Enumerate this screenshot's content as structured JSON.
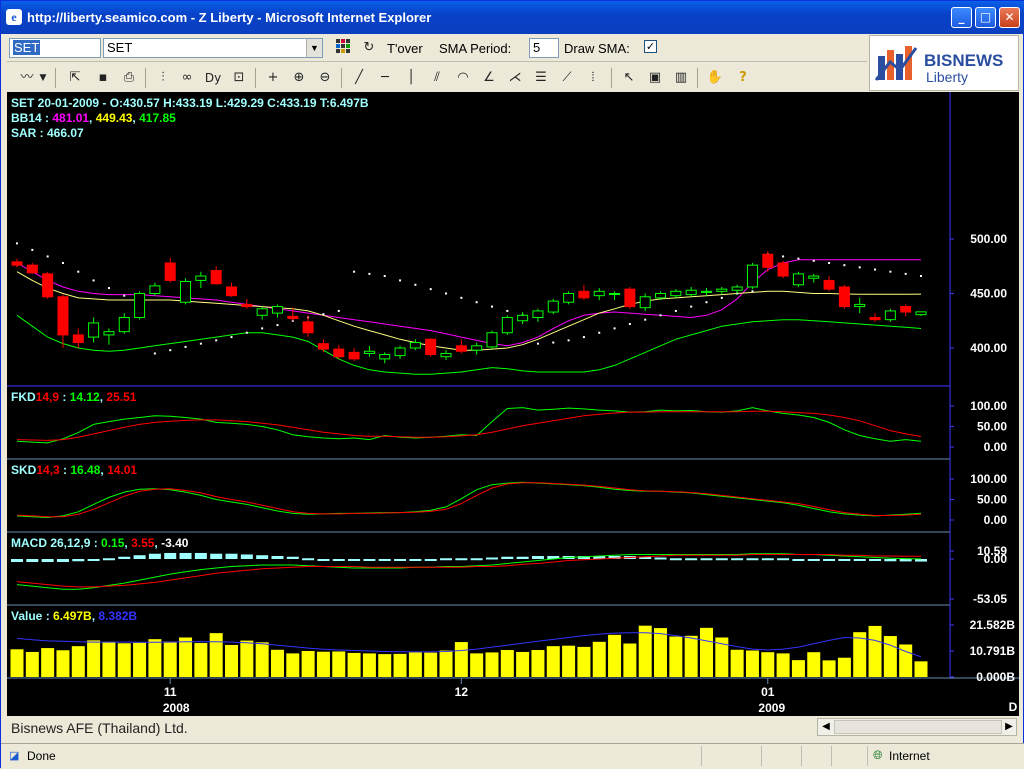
{
  "window": {
    "title": "http://liberty.seamico.com - Z Liberty - Microsoft Internet Explorer",
    "buttons": {
      "min": "_",
      "max": "□",
      "close": "✕"
    }
  },
  "toolbar": {
    "symbol_value": "SET",
    "symbol_select_value": "SET",
    "tover_label": "T'over",
    "sma_period_label": "SMA Period:",
    "sma_period_value": "5",
    "draw_sma_label": "Draw SMA:",
    "draw_sma_checked": "✓"
  },
  "logo": {
    "brand": "BISNEWS",
    "sub": "Liberty",
    "accent": "#e8612c",
    "blue": "#2b4ea0"
  },
  "panels": {
    "main": {
      "line1": "SET 20-01-2009 - O:430.57 H:433.19 L:429.29 C:433.19 T:6.497B",
      "bb_label": "BB14 : ",
      "bb_values": [
        "481.01",
        "449.43",
        "417.85"
      ],
      "sar_label": "SAR : 466.07",
      "y_ticks": [
        "500.00",
        "450.00",
        "400.00"
      ]
    },
    "fkd": {
      "name": "FKD",
      "params": "14,9",
      "colon": " : ",
      "v1": "14.12",
      "v2": "25.51",
      "y_ticks": [
        "100.00",
        "50.00",
        "0.00"
      ]
    },
    "skd": {
      "name": "SKD",
      "params": "14,3",
      "colon": " : ",
      "v1": "16.48",
      "v2": "14.01",
      "y_ticks": [
        "100.00",
        "50.00",
        "0.00"
      ]
    },
    "macd": {
      "name": "MACD 26,12,9 : ",
      "v1": "0.15",
      "v2": "3.55",
      "v3": "-3.40",
      "y_ticks": [
        "10.59",
        "0.00",
        "-53.05"
      ]
    },
    "value": {
      "name": "Value : ",
      "v1": "6.497B",
      "v2": "8.382B",
      "y_ticks": [
        "21.582B",
        "10.791B",
        "0.000B"
      ]
    }
  },
  "x_axis": {
    "months": [
      "11",
      "12",
      "01"
    ],
    "years": [
      "2008",
      "2009"
    ],
    "period": "D"
  },
  "colors": {
    "up": "#00ff00",
    "down": "#ff0000",
    "bb_upper": "#ff00ff",
    "bb_mid": "#ffff80",
    "bb_lower": "#00ff00",
    "axis": "#3a3aff",
    "vol": "#ffff00",
    "vol_ma": "#3333ff",
    "macd_hist": "#a0ffff"
  },
  "status_bar": {
    "company": "Bisnews AFE (Thailand) Ltd."
  },
  "ie_status": {
    "done": "Done",
    "zone": "Internet"
  },
  "chart_data": {
    "type": "candlestick",
    "title": "SET",
    "ylabel": "",
    "candles_ohlc": [
      [
        479,
        482,
        474,
        476
      ],
      [
        476,
        478,
        468,
        469
      ],
      [
        468,
        470,
        445,
        447
      ],
      [
        447,
        449,
        400,
        412
      ],
      [
        412,
        418,
        400,
        405
      ],
      [
        410,
        428,
        405,
        423
      ],
      [
        412,
        418,
        403,
        415
      ],
      [
        415,
        432,
        413,
        428
      ],
      [
        428,
        452,
        426,
        450
      ],
      [
        450,
        460,
        448,
        457
      ],
      [
        478,
        483,
        460,
        462
      ],
      [
        442,
        464,
        440,
        461
      ],
      [
        462,
        470,
        455,
        466
      ],
      [
        471,
        475,
        458,
        459
      ],
      [
        456,
        460,
        447,
        448
      ],
      [
        440,
        445,
        436,
        438
      ],
      [
        430,
        438,
        426,
        436
      ],
      [
        432,
        440,
        428,
        438
      ],
      [
        429,
        437,
        425,
        427
      ],
      [
        424,
        430,
        410,
        414
      ],
      [
        404,
        408,
        396,
        399
      ],
      [
        399,
        403,
        390,
        392
      ],
      [
        396,
        400,
        388,
        390
      ],
      [
        395,
        402,
        392,
        397
      ],
      [
        390,
        396,
        386,
        394
      ],
      [
        393,
        402,
        390,
        400
      ],
      [
        400,
        408,
        398,
        405
      ],
      [
        408,
        409,
        392,
        394
      ],
      [
        392,
        398,
        389,
        395
      ],
      [
        402,
        408,
        395,
        397
      ],
      [
        398,
        405,
        394,
        402
      ],
      [
        401,
        416,
        399,
        414
      ],
      [
        414,
        430,
        412,
        428
      ],
      [
        425,
        433,
        422,
        430
      ],
      [
        428,
        436,
        424,
        434
      ],
      [
        433,
        445,
        431,
        443
      ],
      [
        442,
        452,
        440,
        450
      ],
      [
        452,
        458,
        444,
        446
      ],
      [
        448,
        455,
        444,
        452
      ],
      [
        450,
        452,
        444,
        450
      ],
      [
        454,
        456,
        436,
        438
      ],
      [
        437,
        450,
        434,
        447
      ],
      [
        446,
        452,
        444,
        450
      ],
      [
        448,
        454,
        446,
        452
      ],
      [
        449,
        456,
        447,
        453
      ],
      [
        451,
        455,
        448,
        452
      ],
      [
        452,
        456,
        449,
        454
      ],
      [
        453,
        458,
        450,
        456
      ],
      [
        456,
        478,
        454,
        476
      ],
      [
        486,
        489,
        470,
        474
      ],
      [
        478,
        480,
        464,
        466
      ],
      [
        458,
        470,
        456,
        468
      ],
      [
        464,
        468,
        460,
        466
      ],
      [
        462,
        466,
        452,
        454
      ],
      [
        456,
        458,
        436,
        438
      ],
      [
        438,
        446,
        432,
        440
      ],
      [
        428,
        432,
        424,
        426
      ],
      [
        426,
        436,
        424,
        434
      ],
      [
        438,
        440,
        429,
        433
      ],
      [
        430.57,
        433.19,
        429.29,
        433.19
      ]
    ],
    "bb_upper": [
      478,
      470,
      462,
      456,
      452,
      450,
      449,
      449,
      449,
      448,
      447,
      446,
      445,
      444,
      442,
      440,
      438,
      436,
      434,
      432,
      430,
      428,
      426,
      424,
      422,
      420,
      418,
      416,
      413,
      410,
      407,
      404,
      402,
      405,
      410,
      418,
      425,
      430,
      432,
      433,
      432,
      431,
      430,
      429,
      428,
      430,
      435,
      445,
      460,
      472,
      478,
      481,
      481,
      481,
      481,
      481,
      481,
      481,
      481,
      481.01
    ],
    "bb_mid": [
      470,
      462,
      455,
      450,
      446,
      445,
      444,
      444,
      444,
      444,
      444,
      443,
      442,
      441,
      440,
      439,
      438,
      437,
      436,
      434,
      430,
      425,
      420,
      416,
      412,
      408,
      405,
      402,
      400,
      398,
      398,
      399,
      400,
      403,
      408,
      414,
      420,
      426,
      432,
      436,
      440,
      443,
      445,
      446,
      447,
      448,
      449,
      450,
      451,
      452,
      452,
      451,
      450,
      450,
      449.5,
      449.4,
      449.4,
      449.4,
      449.4,
      449.43
    ],
    "bb_lower": [
      430,
      420,
      410,
      404,
      400,
      398,
      397,
      398,
      400,
      402,
      404,
      406,
      408,
      410,
      412,
      414,
      414,
      412,
      410,
      406,
      398,
      390,
      384,
      380,
      378,
      377,
      376,
      376,
      377,
      378,
      380,
      382,
      381,
      379,
      378,
      378,
      378,
      378,
      380,
      384,
      390,
      396,
      402,
      408,
      412,
      416,
      420,
      422,
      424,
      425,
      426,
      426,
      425,
      424,
      423,
      422,
      421,
      420,
      419,
      417.85
    ],
    "sar": [
      496,
      490,
      484,
      478,
      470,
      462,
      455,
      448,
      440,
      395,
      398,
      401,
      404,
      407,
      410,
      414,
      418,
      421,
      425,
      428,
      431,
      434,
      470,
      468,
      466,
      462,
      458,
      454,
      450,
      446,
      442,
      438,
      434,
      430,
      404,
      405,
      407,
      410,
      414,
      418,
      422,
      426,
      430,
      434,
      438,
      442,
      446,
      450,
      452,
      486,
      484,
      482,
      480,
      478,
      476,
      474,
      472,
      470,
      468,
      466.07
    ],
    "fkd_k": [
      14,
      12,
      10,
      20,
      35,
      55,
      62,
      68,
      72,
      76,
      75,
      72,
      68,
      60,
      58,
      55,
      50,
      42,
      30,
      25,
      22,
      20,
      22,
      18,
      28,
      24,
      22,
      24,
      26,
      30,
      28,
      62,
      94,
      96,
      90,
      92,
      95,
      93,
      90,
      88,
      85,
      86,
      90,
      88,
      89,
      86,
      85,
      88,
      96,
      88,
      82,
      78,
      72,
      60,
      42,
      28,
      20,
      14,
      18,
      14.12
    ],
    "fkd_d": [
      18,
      17,
      16,
      18,
      24,
      32,
      40,
      48,
      55,
      60,
      63,
      65,
      66,
      66,
      64,
      62,
      58,
      54,
      48,
      42,
      36,
      32,
      28,
      26,
      26,
      25,
      24,
      24,
      25,
      27,
      30,
      36,
      44,
      52,
      58,
      64,
      70,
      76,
      80,
      83,
      85,
      85,
      86,
      86,
      86,
      86,
      86,
      86,
      87,
      87,
      86,
      84,
      82,
      78,
      72,
      64,
      52,
      40,
      32,
      25.51
    ],
    "skd_k": [
      10,
      8,
      6,
      10,
      20,
      38,
      55,
      68,
      75,
      76,
      74,
      68,
      60,
      50,
      44,
      38,
      30,
      22,
      16,
      14,
      15,
      16,
      16,
      17,
      18,
      18,
      20,
      24,
      32,
      52,
      74,
      86,
      90,
      92,
      90,
      88,
      86,
      84,
      80,
      75,
      72,
      70,
      70,
      68,
      66,
      62,
      58,
      54,
      50,
      46,
      42,
      36,
      28,
      20,
      15,
      12,
      10,
      12,
      14,
      16.48
    ],
    "skd_d": [
      12,
      10,
      8,
      8,
      14,
      26,
      42,
      58,
      70,
      75,
      76,
      72,
      66,
      57,
      50,
      44,
      36,
      28,
      20,
      16,
      15,
      15,
      16,
      16,
      17,
      18,
      19,
      21,
      26,
      40,
      60,
      78,
      88,
      91,
      91,
      89,
      87,
      85,
      82,
      78,
      74,
      71,
      70,
      69,
      67,
      64,
      60,
      56,
      52,
      48,
      44,
      40,
      33,
      25,
      18,
      14,
      11,
      11,
      12,
      14.01
    ],
    "macd_line": [
      -34,
      -36,
      -38,
      -40,
      -40,
      -38,
      -35,
      -32,
      -28,
      -24,
      -20,
      -17,
      -14,
      -12,
      -10,
      -9,
      -8,
      -8,
      -8,
      -9,
      -10,
      -11,
      -12,
      -12,
      -12,
      -12,
      -11,
      -11,
      -10,
      -10,
      -9,
      -8,
      -6,
      -4,
      -2,
      0,
      2,
      3,
      4,
      5,
      6,
      6,
      6,
      6,
      6,
      6,
      6,
      6,
      7,
      7,
      7,
      6,
      6,
      5,
      4,
      3,
      2,
      1,
      0.5,
      0.15
    ],
    "macd_signal": [
      -30,
      -32,
      -34,
      -36,
      -37,
      -37,
      -36,
      -35,
      -33,
      -31,
      -28,
      -25,
      -22,
      -19,
      -17,
      -15,
      -13,
      -12,
      -11,
      -10,
      -10,
      -10,
      -10,
      -11,
      -11,
      -11,
      -11,
      -11,
      -11,
      -11,
      -10,
      -10,
      -9,
      -7,
      -6,
      -4,
      -2,
      -1,
      0,
      1,
      2,
      3,
      4,
      5,
      5,
      5,
      5,
      5,
      6,
      6,
      6,
      6,
      6,
      6,
      5,
      5,
      4,
      4,
      3.7,
      3.55
    ],
    "value_bn": [
      11.5,
      10.4,
      12.0,
      11.1,
      12.8,
      15.2,
      14.6,
      14.0,
      14.2,
      15.7,
      14.7,
      16.4,
      14.1,
      18.2,
      13.3,
      15.1,
      14.4,
      11.3,
      9.8,
      10.8,
      10.5,
      10.6,
      10.0,
      9.8,
      9.5,
      9.6,
      10.2,
      10.1,
      11.0,
      14.5,
      9.8,
      10.2,
      11.2,
      10.4,
      11.2,
      12.8,
      13.0,
      12.5,
      14.6,
      17.5,
      13.9,
      21.3,
      20.3,
      16.8,
      17.1,
      20.4,
      16.4,
      11.3,
      11.0,
      10.3,
      9.8,
      7.0,
      10.3,
      6.9,
      8.0,
      18.6,
      21.2,
      17.0,
      13.5,
      6.497
    ],
    "value_ma_bn": [
      16,
      15.5,
      15,
      14.8,
      14.6,
      14.5,
      14.5,
      14.5,
      14.4,
      14.4,
      14.5,
      14.6,
      14.7,
      14.6,
      14.5,
      14.2,
      13.8,
      13.2,
      12.6,
      12.0,
      11.5,
      11.2,
      11.0,
      10.8,
      10.6,
      10.5,
      10.4,
      10.4,
      10.6,
      11.0,
      11.6,
      12.4,
      13.2,
      14.0,
      14.8,
      15.6,
      16.4,
      17.2,
      17.8,
      18.2,
      18.4,
      18.4,
      18.0,
      17.2,
      16.2,
      15.0,
      13.8,
      12.6,
      11.6,
      11.2,
      11.6,
      12.4,
      13.8,
      15.2,
      16.4,
      16.2,
      15.2,
      13.2,
      10.6,
      8.382
    ]
  }
}
